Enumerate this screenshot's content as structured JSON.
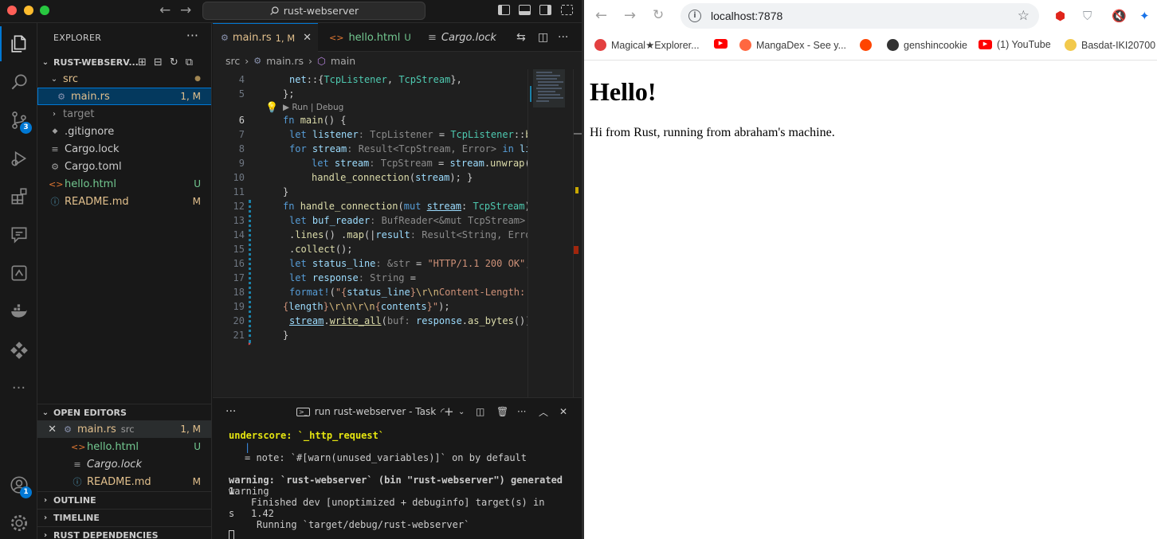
{
  "vscode": {
    "search_text": "rust-webserver",
    "activity_badges": {
      "source_control": "3",
      "accounts": "1"
    },
    "explorer": {
      "title": "EXPLORER",
      "root": "RUST-WEBSERV...",
      "items": [
        {
          "label": "src",
          "kind": "folder-open",
          "status": "●"
        },
        {
          "label": "main.rs",
          "kind": "rust",
          "status": "1, M"
        },
        {
          "label": "target",
          "kind": "folder",
          "status": ""
        },
        {
          "label": ".gitignore",
          "kind": "git",
          "status": ""
        },
        {
          "label": "Cargo.lock",
          "kind": "lock",
          "status": ""
        },
        {
          "label": "Cargo.toml",
          "kind": "gear",
          "status": ""
        },
        {
          "label": "hello.html",
          "kind": "html",
          "status": "U"
        },
        {
          "label": "README.md",
          "kind": "info",
          "status": "M"
        }
      ]
    },
    "open_editors": {
      "title": "OPEN EDITORS",
      "items": [
        {
          "label": "main.rs",
          "desc": "src",
          "status": "1, M"
        },
        {
          "label": "hello.html",
          "desc": "",
          "status": "U"
        },
        {
          "label": "Cargo.lock",
          "desc": "",
          "status": ""
        },
        {
          "label": "README.md",
          "desc": "",
          "status": "M"
        }
      ]
    },
    "sections": [
      "OUTLINE",
      "TIMELINE",
      "RUST DEPENDENCIES"
    ],
    "tabs": [
      {
        "label": "main.rs",
        "status": "1, M",
        "active": true
      },
      {
        "label": "hello.html",
        "status": "U",
        "active": false
      },
      {
        "label": "Cargo.lock",
        "status": "",
        "active": false
      }
    ],
    "breadcrumb": [
      "src",
      "main.rs",
      "main"
    ],
    "codelens": "▶ Run | Debug",
    "line_numbers": [
      "4",
      "5",
      "6",
      "7",
      "8",
      "9",
      "10",
      "11",
      "12",
      "13",
      "14",
      "15",
      "16",
      "17",
      "18",
      "19",
      "20",
      "21"
    ],
    "terminal": {
      "title": "run rust-webserver - Task",
      "lines": [
        "underscore: `_http_request`",
        "|",
        "= note: `#[warn(unused_variables)]` on by default",
        "warning: `rust-webserver` (bin \"rust-webserver\") generated 1",
        " warning",
        "Finished dev [unoptimized + debuginfo] target(s) in 1.42",
        "s",
        "Running `target/debug/rust-webserver`"
      ]
    }
  },
  "browser": {
    "url": "localhost:7878",
    "bookmarks": [
      "Magical★Explorer...",
      "",
      "MangaDex - See y...",
      "",
      "genshincookie",
      "(1) YouTube",
      "Basdat-IKI20700"
    ],
    "page": {
      "heading": "Hello!",
      "body": "Hi from Rust, running from abraham's machine."
    }
  }
}
